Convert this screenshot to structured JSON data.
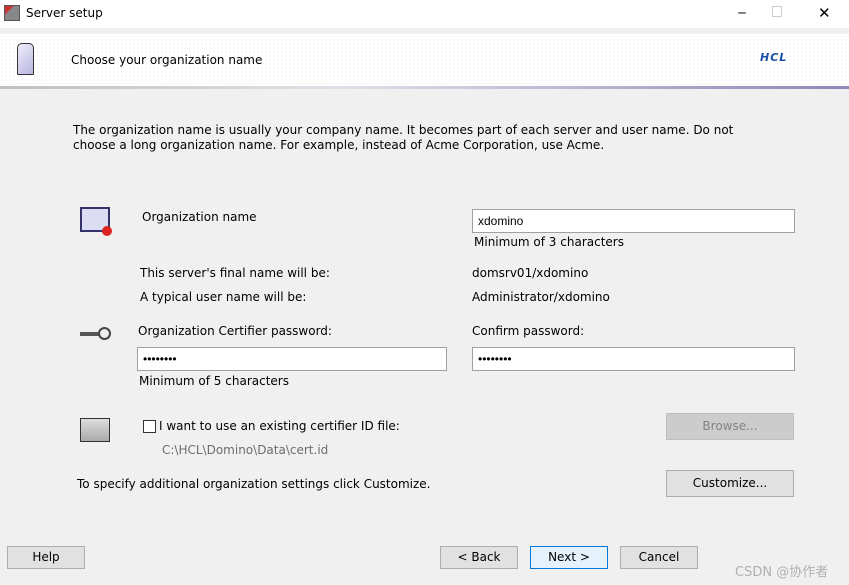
{
  "window": {
    "title": "Server setup"
  },
  "banner": {
    "heading": "Choose your organization name",
    "logo": "HCL",
    "logo_color": "#1a4fa8"
  },
  "intro": "The organization name is usually your company name. It becomes part of each server and user name. Do not choose a long organization name. For example, instead of Acme Corporation, use Acme.",
  "org": {
    "label": "Organization name",
    "value": "xdomino",
    "hint": "Minimum of 3 characters"
  },
  "server_name": {
    "label": "This server's final name will be:",
    "value": "domsrv01/xdomino"
  },
  "user_name": {
    "label": "A typical user name will be:",
    "value": "Administrator/xdomino"
  },
  "password": {
    "label": "Organization Certifier password:",
    "value": "••••••••",
    "hint": "Minimum of 5 characters"
  },
  "confirm": {
    "label": "Confirm password:",
    "value": "••••••••"
  },
  "certifier": {
    "checkbox_label": "I want to use an existing certifier ID file:",
    "checked": false,
    "path": "C:\\HCL\\Domino\\Data\\cert.id",
    "browse": "Browse..."
  },
  "customize": {
    "text": "To specify additional organization settings click Customize.",
    "button": "Customize..."
  },
  "footer": {
    "help": "Help",
    "back": "< Back",
    "next": "Next >",
    "cancel": "Cancel"
  },
  "watermark": "CSDN @协作者"
}
